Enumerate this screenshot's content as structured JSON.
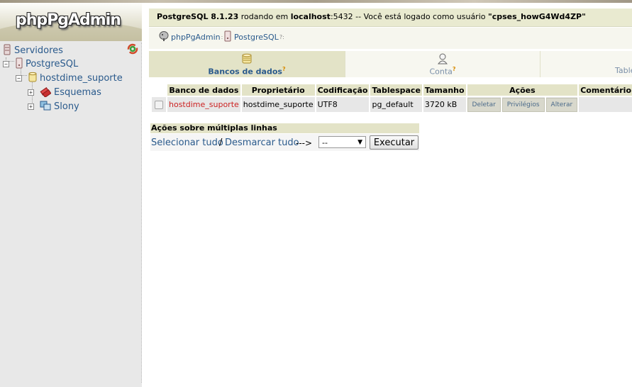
{
  "app": {
    "logo_text": "phpPgAdmin"
  },
  "sidebar": {
    "tree": [
      {
        "label": "Servidores",
        "icon": "servers-icon"
      },
      {
        "label": "PostgreSQL",
        "icon": "server-icon"
      },
      {
        "label": "hostdime_suporte",
        "icon": "database-icon"
      },
      {
        "label": "Esquemas",
        "icon": "schemas-icon"
      },
      {
        "label": "Slony",
        "icon": "slony-icon"
      }
    ],
    "refresh_icon": "refresh-icon"
  },
  "topbar": {
    "server_version": "PostgreSQL 8.1.23",
    "running_on": "rodando em",
    "host": "localhost",
    "port_text": ":5432 -- Você está logado como usuário",
    "user": "\"cpses_howG4Wd4ZP\""
  },
  "breadcrumb": [
    {
      "label": "phpPgAdmin",
      "suffix": ":"
    },
    {
      "label": "PostgreSQL",
      "suffix": "?:"
    }
  ],
  "tabs": [
    {
      "label": "Bancos de dados",
      "help": "?",
      "active": true,
      "icon": "database-icon"
    },
    {
      "label": "Conta",
      "help": "?",
      "active": false,
      "icon": "user-icon"
    },
    {
      "label": "Table",
      "help": "",
      "active": false,
      "icon": ""
    }
  ],
  "table": {
    "headers": [
      "Banco de dados",
      "Proprietário",
      "Codificação",
      "Tablespace",
      "Tamanho",
      "Ações",
      "Comentário"
    ],
    "rows": [
      {
        "name": "hostdime_suporte",
        "owner": "hostdime_suporte",
        "encoding": "UTF8",
        "tablespace": "pg_default",
        "size": "3720 kB",
        "actions": [
          "Deletar",
          "Privilégios",
          "Alterar"
        ],
        "comment": ""
      }
    ]
  },
  "multi_actions": {
    "title": "Ações sobre múltiplas linhas",
    "select_all": "Selecionar tudo",
    "separator": "/",
    "deselect_all": "Desmarcar tudo",
    "arrow": "--->",
    "select_value": "--",
    "execute_label": "Executar"
  }
}
